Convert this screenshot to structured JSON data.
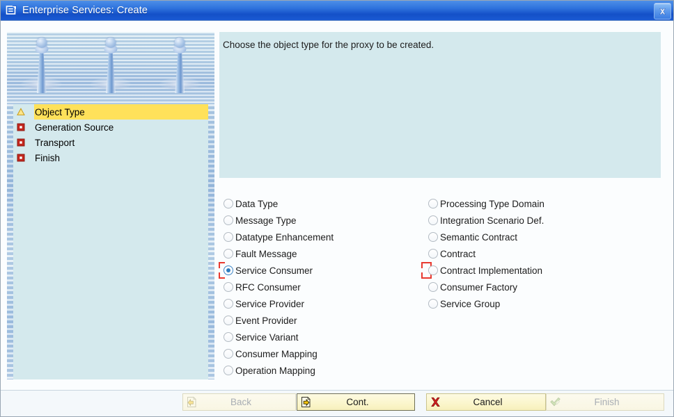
{
  "window": {
    "title": "Enterprise Services: Create",
    "title_icon": "create-object-icon",
    "close_icon": "close-icon"
  },
  "sidebar": {
    "illustration": "water-drop-ripple-image",
    "steps": [
      {
        "label": "Object Type",
        "icon": "warning-triangle-icon",
        "state": "current"
      },
      {
        "label": "Generation Source",
        "icon": "red-square-icon",
        "state": "pending"
      },
      {
        "label": "Transport",
        "icon": "red-square-icon",
        "state": "pending"
      },
      {
        "label": "Finish",
        "icon": "red-square-icon",
        "state": "pending"
      }
    ]
  },
  "instruction": {
    "text": "Choose the object type for the proxy to be created."
  },
  "options": {
    "group_name": "object-type",
    "left_column": [
      {
        "label": "Data Type",
        "selected": false,
        "focused": false
      },
      {
        "label": "Message Type",
        "selected": false,
        "focused": false
      },
      {
        "label": "Datatype Enhancement",
        "selected": false,
        "focused": false
      },
      {
        "label": "Fault Message",
        "selected": false,
        "focused": false
      },
      {
        "label": "Service Consumer",
        "selected": true,
        "focused": true
      },
      {
        "label": "RFC Consumer",
        "selected": false,
        "focused": false
      },
      {
        "label": "Service Provider",
        "selected": false,
        "focused": false
      },
      {
        "label": "Event Provider",
        "selected": false,
        "focused": false
      },
      {
        "label": "Service Variant",
        "selected": false,
        "focused": false
      },
      {
        "label": "Consumer Mapping",
        "selected": false,
        "focused": false
      },
      {
        "label": "Operation Mapping",
        "selected": false,
        "focused": false
      }
    ],
    "right_column": [
      {
        "label": "Processing Type Domain",
        "selected": false,
        "focused": false
      },
      {
        "label": "Integration Scenario Def.",
        "selected": false,
        "focused": false
      },
      {
        "label": "Semantic Contract",
        "selected": false,
        "focused": false
      },
      {
        "label": "Contract",
        "selected": false,
        "focused": false
      },
      {
        "label": "Contract Implementation",
        "selected": false,
        "focused": true
      },
      {
        "label": "Consumer Factory",
        "selected": false,
        "focused": false
      },
      {
        "label": "Service Group",
        "selected": false,
        "focused": false
      }
    ]
  },
  "footer": {
    "back": {
      "label": "Back",
      "icon": "back-arrow-icon",
      "enabled": false,
      "default": false
    },
    "cont": {
      "label": "Cont.",
      "icon": "forward-arrow-icon",
      "enabled": true,
      "default": true
    },
    "cancel": {
      "label": "Cancel",
      "icon": "red-x-icon",
      "enabled": true,
      "default": false
    },
    "finish": {
      "label": "Finish",
      "icon": "green-check-icon",
      "enabled": false,
      "default": false
    }
  },
  "colors": {
    "titlebar_blue": "#1450c8",
    "panel_teal": "#d4e9ed",
    "highlight_yellow": "#ffe15a",
    "focus_red": "#e8392f",
    "radio_blue": "#2f7ec0",
    "button_yellow": "#fbf6cd"
  }
}
